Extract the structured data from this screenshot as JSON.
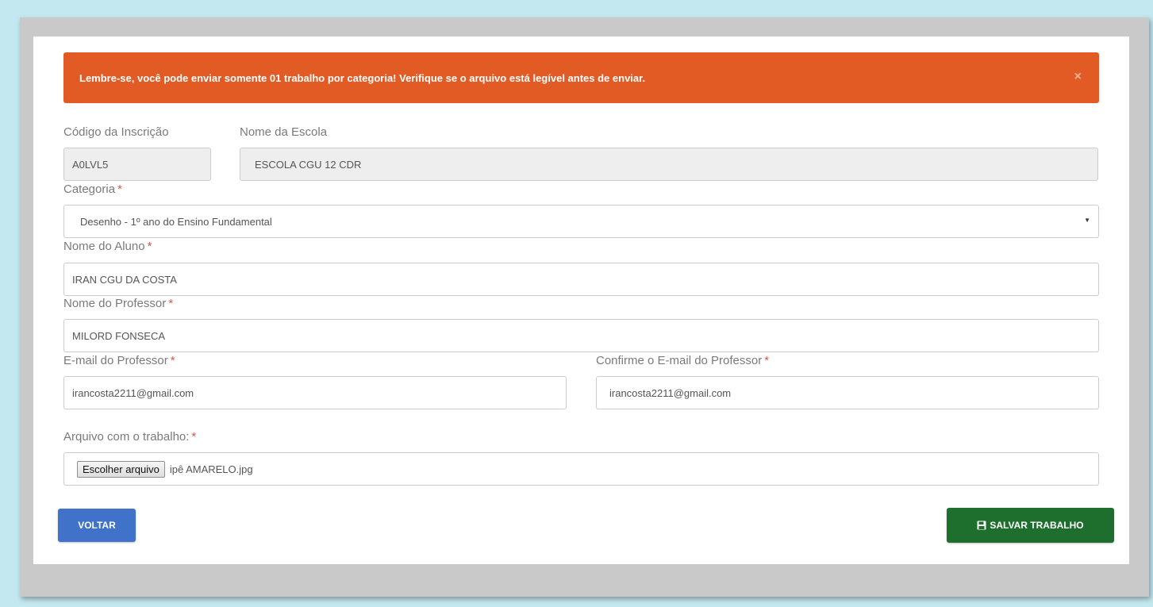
{
  "alert": {
    "message": "Lembre-se, você pode enviar somente 01 trabalho por categoria! Verifique se o arquivo está legível antes de enviar.",
    "close_label": "×"
  },
  "form": {
    "codigo": {
      "label": "Código da Inscrição",
      "value": "A0LVL5"
    },
    "escola": {
      "label": "Nome da Escola",
      "value": "ESCOLA CGU 12 CDR"
    },
    "categoria": {
      "label": "Categoria",
      "value": "Desenho - 1º ano do Ensino Fundamental",
      "required": "*"
    },
    "aluno": {
      "label": "Nome do Aluno",
      "value": "IRAN CGU DA COSTA",
      "required": "*"
    },
    "professor": {
      "label": "Nome do Professor",
      "value": "MILORD FONSECA",
      "required": "*"
    },
    "email": {
      "label": "E-mail do Professor",
      "value": "irancosta2211@gmail.com",
      "required": "*"
    },
    "email_confirm": {
      "label": "Confirme o E-mail do Professor",
      "value": "irancosta2211@gmail.com",
      "required": "*"
    },
    "arquivo": {
      "label": "Arquivo com o trabalho:",
      "button_label": "Escolher arquivo",
      "file_name": "ipê AMARELO.jpg",
      "required": "*"
    }
  },
  "buttons": {
    "back_label": "VOLTAR",
    "save_label": "SALVAR TRABALHO",
    "save_icon": "floppy-disk-icon"
  },
  "colors": {
    "alert": "#e35b24",
    "back_button": "#3f72c8",
    "save_button": "#1e6f2e",
    "required": "#d9534f"
  }
}
